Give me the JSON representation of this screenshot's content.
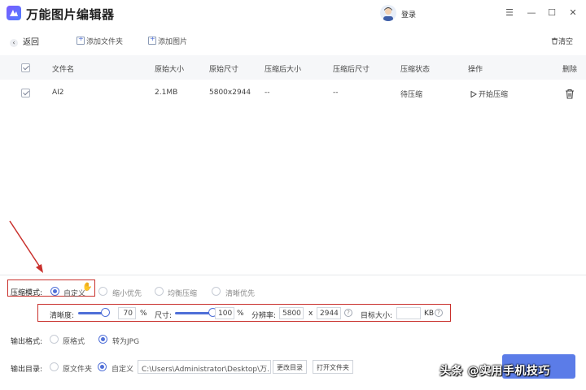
{
  "app": {
    "title": "万能图片编辑器",
    "login": "登录"
  },
  "window": {
    "menu": "☰",
    "minimize": "—",
    "maximize": "☐",
    "close": "✕"
  },
  "toolbar": {
    "back": "返回",
    "add_folder": "添加文件夹",
    "add_image": "添加图片",
    "clear": "清空"
  },
  "table": {
    "headers": [
      "文件名",
      "原始大小",
      "原始尺寸",
      "压缩后大小",
      "压缩后尺寸",
      "压缩状态",
      "操作",
      "删除"
    ],
    "rows": [
      {
        "name": "AI2",
        "size": "2.1MB",
        "dims": "5800x2944",
        "new_size": "--",
        "new_dims": "--",
        "status": "待压缩",
        "action": "开始压缩"
      }
    ]
  },
  "compress": {
    "label": "压缩模式:",
    "options": [
      "自定义",
      "缩小优先",
      "均衡压缩",
      "清晰优先"
    ],
    "selected": 0,
    "clarity_label": "清晰度:",
    "clarity_value": "70",
    "clarity_unit": "%",
    "size_label": "尺寸:",
    "size_value": "100",
    "size_unit": "%",
    "resolution_label": "分辨率:",
    "res_w": "5800",
    "res_x": "x",
    "res_h": "2944",
    "target_label": "目标大小:",
    "target_value": "",
    "target_unit": "KB",
    "clarity_level": 0.7,
    "size_level": 1.0
  },
  "format": {
    "label": "输出格式:",
    "options": [
      "原格式",
      "转为JPG"
    ],
    "selected": 1
  },
  "output": {
    "label": "输出目录:",
    "options": [
      "原文件夹",
      "自定义"
    ],
    "selected": 1,
    "path": "C:\\Users\\Administrator\\Desktop\\万...",
    "change_btn": "更改目录",
    "open_btn": "打开文件夹"
  },
  "watermark": "头条 @实用手机技巧",
  "colors": {
    "accent": "#4f6fd8",
    "highlight_box": "#c9302c",
    "primary_button": "#5b7ce8"
  }
}
